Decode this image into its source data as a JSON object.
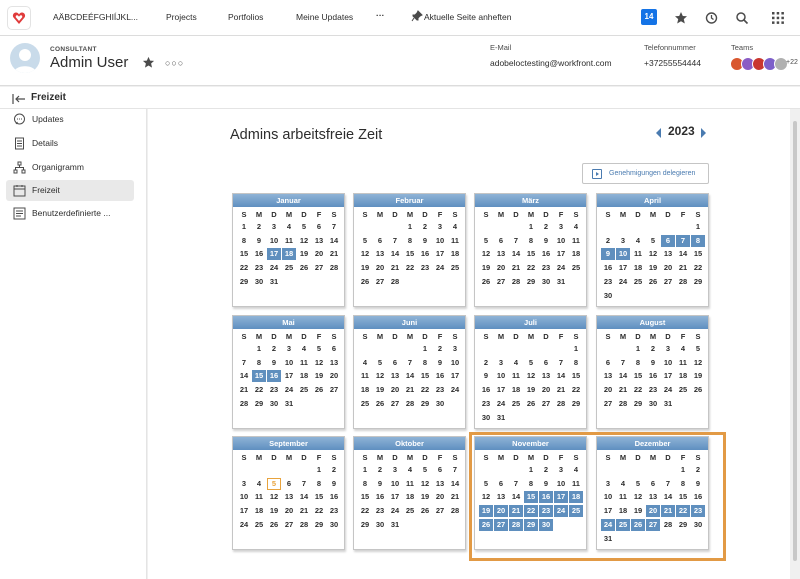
{
  "topbar": {
    "org_name": "AÄBCDEÉFGHIÍJKL...",
    "nav": [
      "Projects",
      "Portfolios",
      "Meine Updates"
    ],
    "more": "···",
    "pin_label": "Aktuelle Seite anheften",
    "notification_count": "14"
  },
  "user": {
    "role": "CONSULTANT",
    "name": "Admin User",
    "more": "○○○",
    "email_label": "E-Mail",
    "email": "adobeloctesting@workfront.com",
    "phone_label": "Telefonnummer",
    "phone": "+37255554444",
    "teams_label": "Teams",
    "teams_more": "+22",
    "team_colors": [
      "#d9572f",
      "#8a5cc4",
      "#c9362f",
      "#7d5fc9",
      "#b0b0b0"
    ]
  },
  "sidebar": {
    "header": "Freizeit",
    "items": [
      {
        "label": "Updates"
      },
      {
        "label": "Details"
      },
      {
        "label": "Organigramm"
      },
      {
        "label": "Freizeit"
      },
      {
        "label": "Benutzerdefinierte ..."
      }
    ]
  },
  "main": {
    "title": "Admins arbeitsfreie Zeit",
    "year": "2023",
    "delegate_label": "Genehmigungen delegieren"
  },
  "calendar": {
    "weekdays": [
      "S",
      "M",
      "D",
      "M",
      "D",
      "F",
      "S"
    ],
    "months": [
      {
        "name": "Januar",
        "start": 0,
        "days": 31,
        "off": [
          17,
          18
        ]
      },
      {
        "name": "Februar",
        "start": 3,
        "days": 28,
        "off": []
      },
      {
        "name": "März",
        "start": 3,
        "days": 31,
        "off": []
      },
      {
        "name": "April",
        "start": 6,
        "days": 30,
        "off": [
          6,
          7,
          8,
          9,
          10
        ]
      },
      {
        "name": "Mai",
        "start": 1,
        "days": 31,
        "off": [
          15,
          16
        ]
      },
      {
        "name": "Juni",
        "start": 4,
        "days": 30,
        "off": []
      },
      {
        "name": "Juli",
        "start": 6,
        "days": 31,
        "off": []
      },
      {
        "name": "August",
        "start": 2,
        "days": 31,
        "off": []
      },
      {
        "name": "September",
        "start": 5,
        "days": 30,
        "off": [],
        "today": 5
      },
      {
        "name": "Oktober",
        "start": 0,
        "days": 31,
        "off": []
      },
      {
        "name": "November",
        "start": 3,
        "days": 30,
        "off": [
          15,
          16,
          17,
          18,
          19,
          20,
          21,
          22,
          23,
          24,
          25,
          26,
          27,
          28,
          29,
          30
        ]
      },
      {
        "name": "Dezember",
        "start": 5,
        "days": 31,
        "off": [
          20,
          21,
          22,
          23,
          24,
          25,
          26,
          27
        ]
      }
    ]
  }
}
